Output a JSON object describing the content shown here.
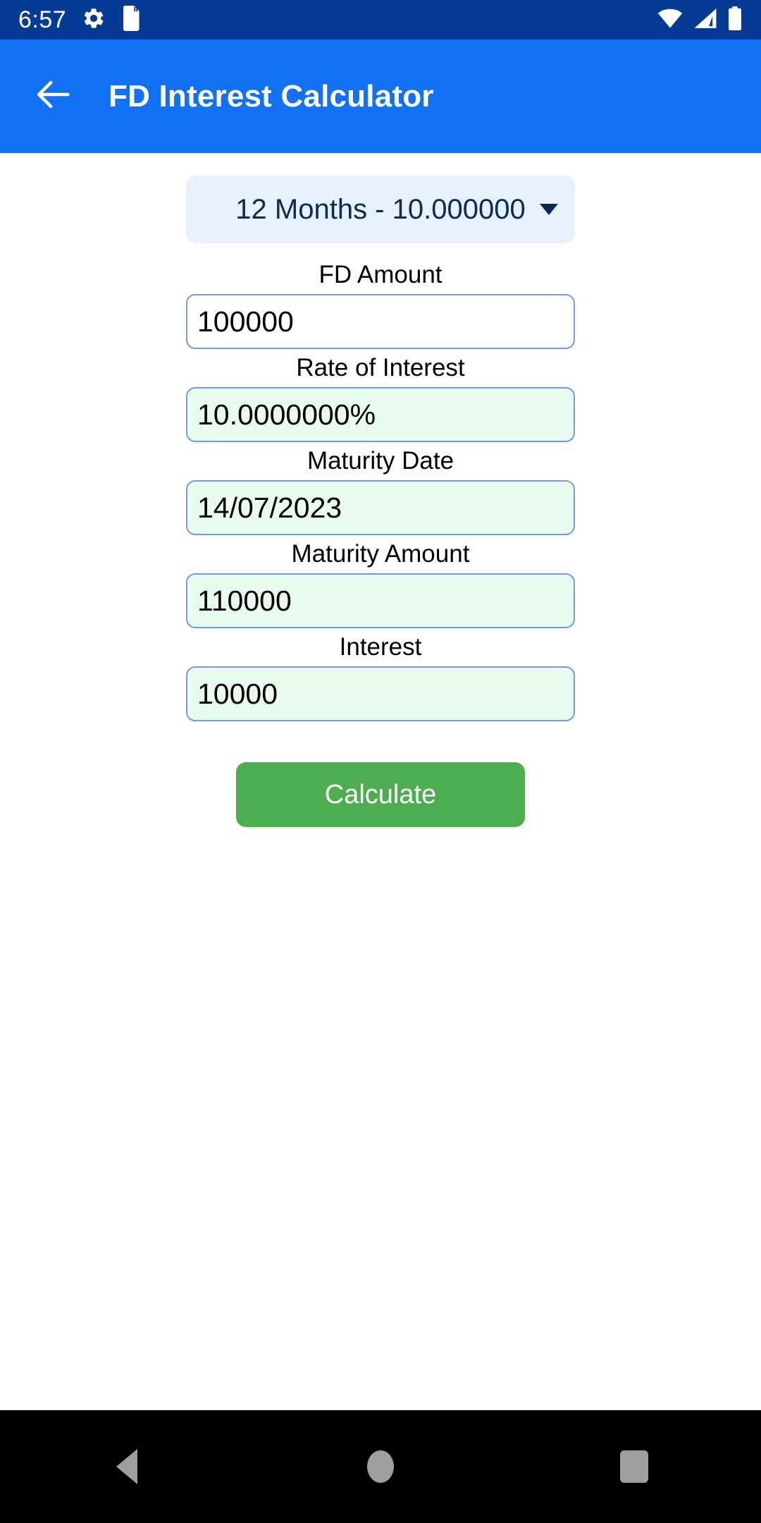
{
  "status_bar": {
    "clock": "6:57",
    "left_icons": [
      "gear-icon",
      "sd-card-icon"
    ],
    "right_icons": [
      "wifi-icon",
      "cellular-signal-icon",
      "battery-icon"
    ],
    "background_color": "#053a95"
  },
  "app_bar": {
    "title": "FD Interest Calculator",
    "back_icon": "arrow-left-icon",
    "background_color": "#1270f5"
  },
  "form": {
    "term_select": {
      "selected": "12 Months - 10.000000",
      "caret_icon": "chevron-down-icon",
      "background_color": "#e7f0fd",
      "text_color": "#0c2a52"
    },
    "fields": [
      {
        "label": "FD Amount",
        "value": "100000",
        "placeholder": "FD Amount",
        "editable": true,
        "background_color": "#ffffff"
      },
      {
        "label": "Rate of Interest",
        "value": "10.0000000%",
        "placeholder": "Rate of Interest",
        "editable": false,
        "background_color": "#e8fdf0"
      },
      {
        "label": "Maturity Date",
        "value": "14/07/2023",
        "placeholder": "Maturity Date",
        "editable": false,
        "background_color": "#e8fdf0"
      },
      {
        "label": "Maturity Amount",
        "value": "110000",
        "placeholder": "Maturity Amount",
        "editable": false,
        "background_color": "#e8fdf0"
      },
      {
        "label": "Interest",
        "value": "10000",
        "placeholder": "Interest",
        "editable": false,
        "background_color": "#e8fdf0"
      }
    ],
    "calculate_label": "Calculate",
    "calculate_color": "#4cae50",
    "field_border_color": "#7b97e7"
  },
  "nav_bar": {
    "back_icon": "triangle-back-icon",
    "home_icon": "circle-home-icon",
    "recents_icon": "square-recents-icon",
    "background_color": "#000000"
  }
}
